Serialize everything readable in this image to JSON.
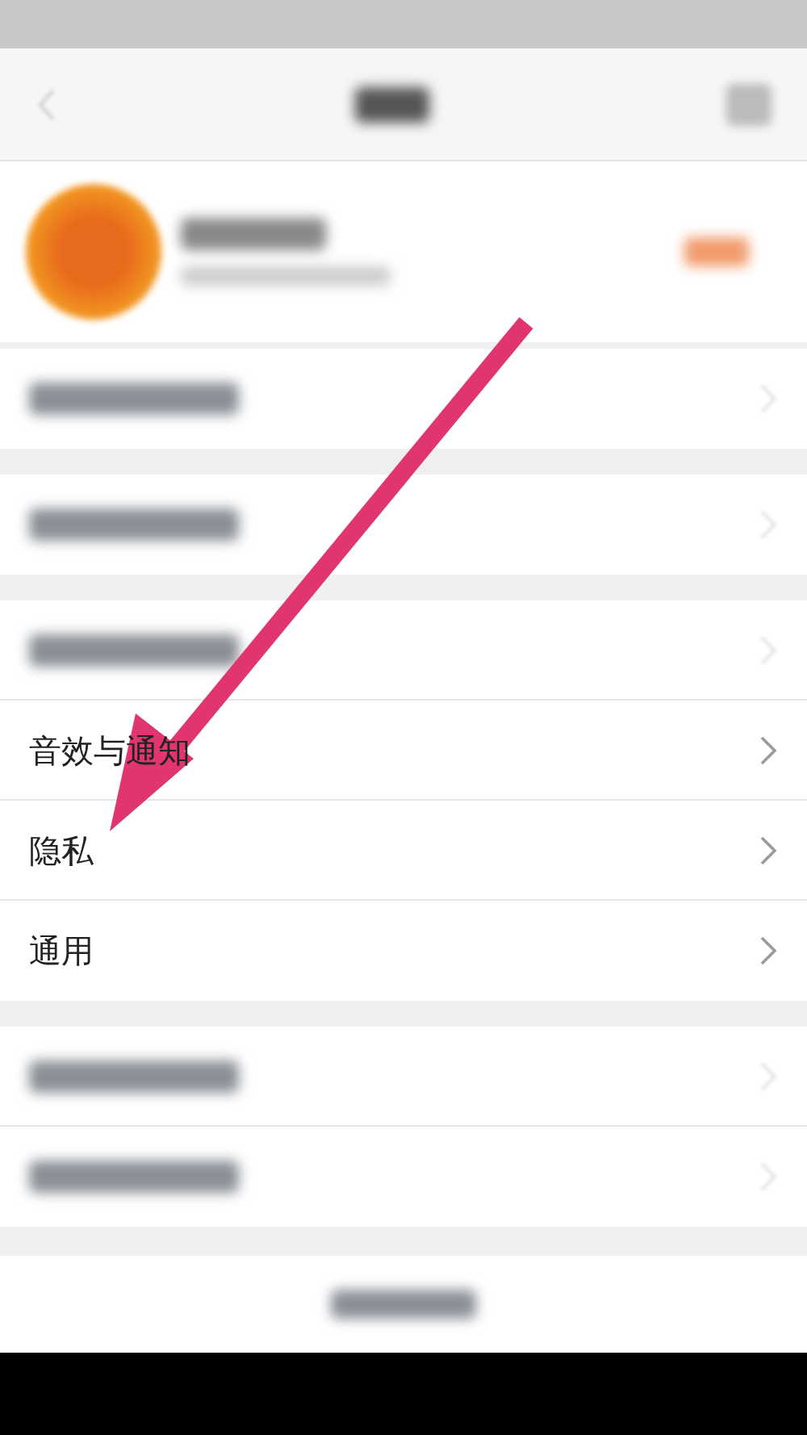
{
  "groups": [
    {
      "rows": [
        {
          "kind": "blurred"
        }
      ]
    },
    {
      "rows": [
        {
          "kind": "blurred"
        }
      ]
    },
    {
      "rows": [
        {
          "kind": "blurred"
        },
        {
          "kind": "text",
          "label": "音效与通知"
        },
        {
          "kind": "text",
          "label": "隐私"
        },
        {
          "kind": "text",
          "label": "通用"
        }
      ]
    },
    {
      "rows": [
        {
          "kind": "blurred"
        },
        {
          "kind": "blurred"
        }
      ]
    }
  ],
  "annotation": {
    "kind": "arrow"
  }
}
